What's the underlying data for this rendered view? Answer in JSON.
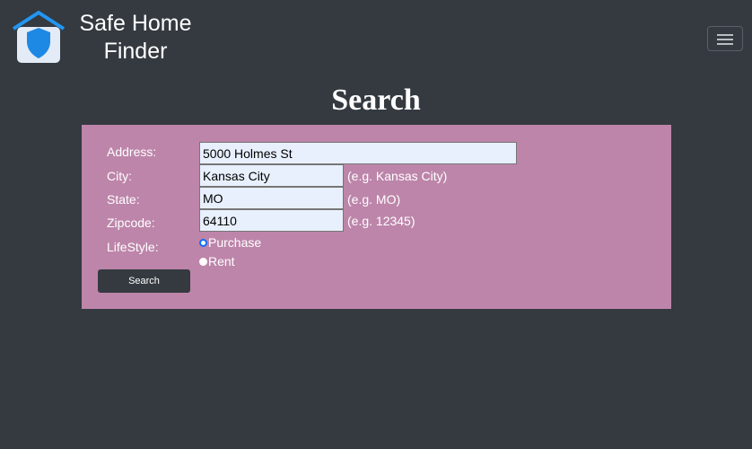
{
  "navbar": {
    "brand_line1": "Safe Home",
    "brand_line2": "Finder",
    "logo_icon": "house-shield-icon",
    "menu_icon": "hamburger-menu-icon"
  },
  "page": {
    "title": "Search"
  },
  "form": {
    "address": {
      "label": "Address:",
      "value": "5000 Holmes St"
    },
    "city": {
      "label": "City:",
      "value": "Kansas City",
      "hint": "(e.g. Kansas City)"
    },
    "state": {
      "label": "State:",
      "value": "MO",
      "hint": "(e.g. MO)"
    },
    "zipcode": {
      "label": "Zipcode:",
      "value": "64110",
      "hint": "(e.g. 12345)"
    },
    "lifestyle": {
      "label": "LifeStyle:",
      "options": [
        "Purchase",
        "Rent"
      ],
      "selected": "Purchase"
    },
    "submit_label": "Search"
  },
  "colors": {
    "background": "#343a40",
    "panel": "#bd85aa",
    "input_bg": "#e8f0fe",
    "logo_blue": "#1e88e5"
  }
}
